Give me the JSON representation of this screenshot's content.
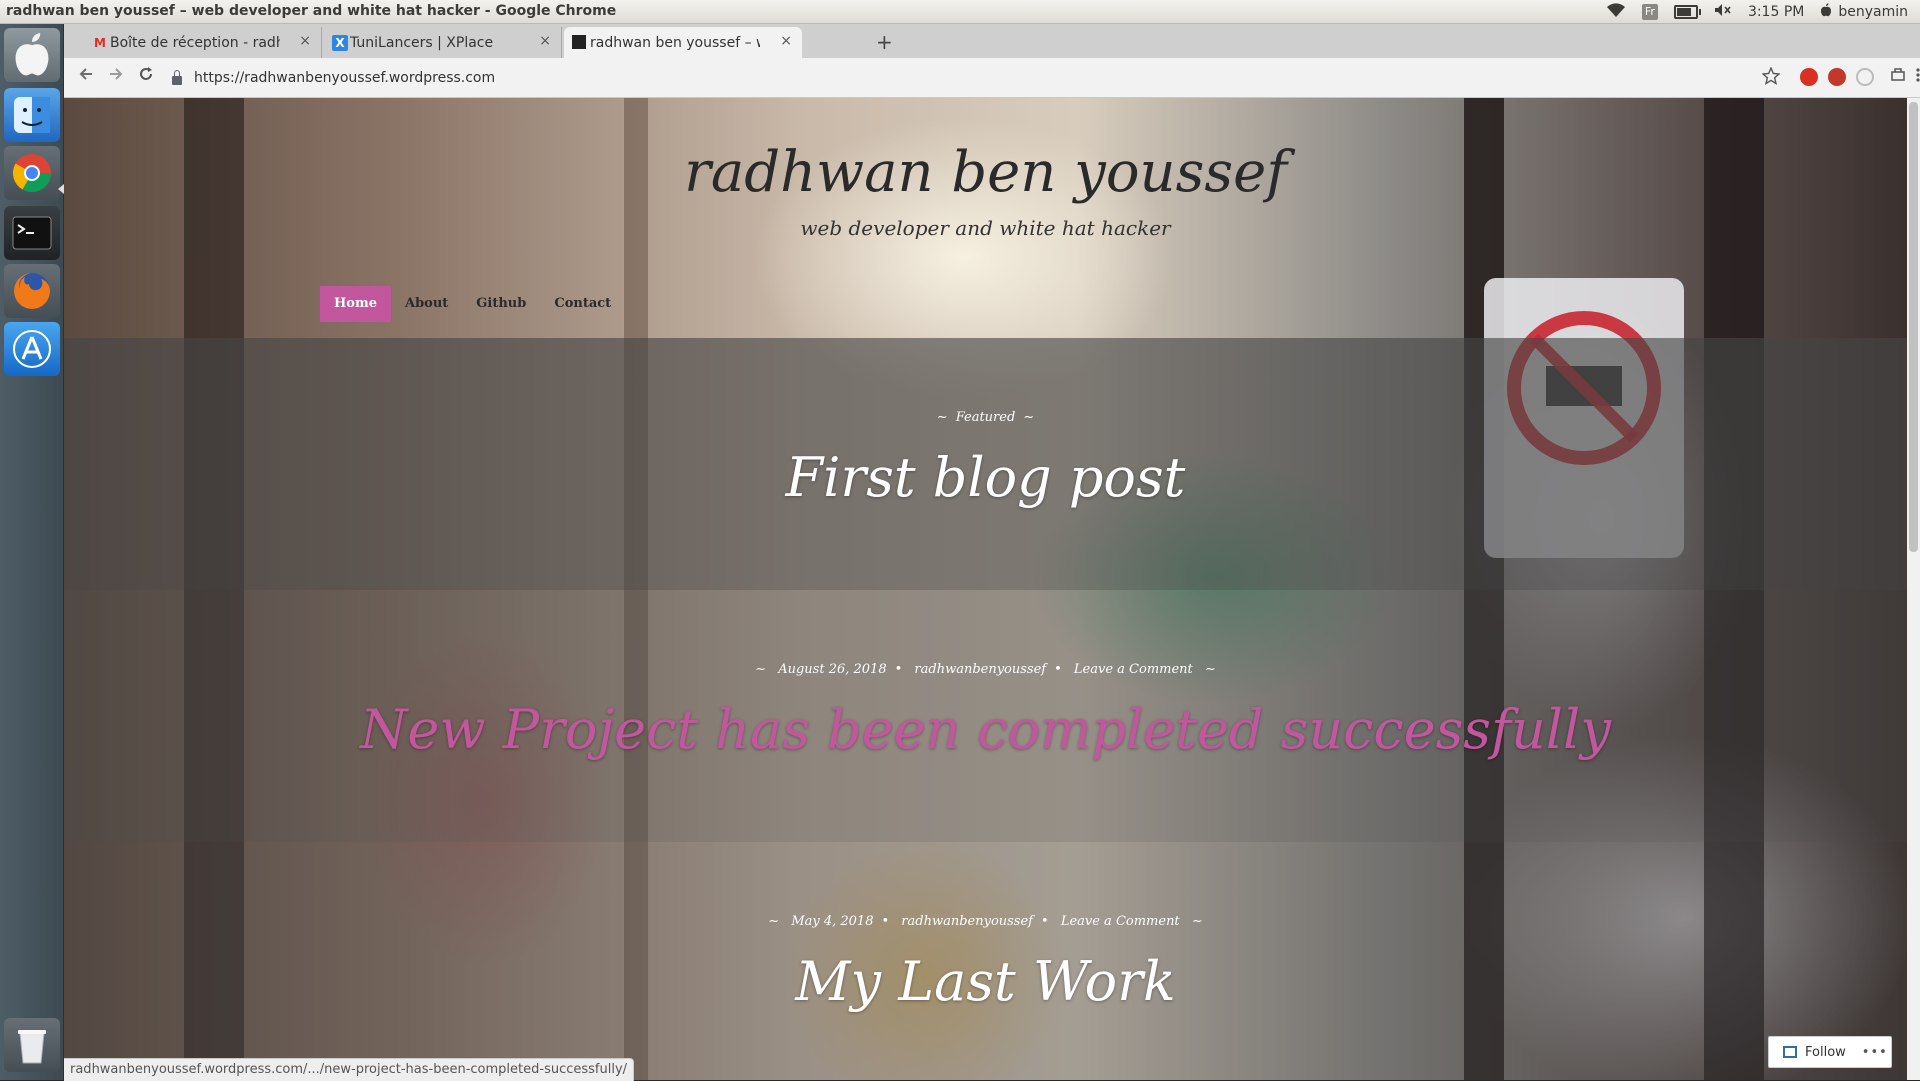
{
  "os": {
    "window_title": "radhwan ben youssef – web developer and white hat hacker - Google Chrome",
    "keyboard_layout": "Fr",
    "time": "3:15 PM",
    "user": "benyamin",
    "icons": [
      "wifi-icon",
      "keyboard-layout-icon",
      "battery-icon",
      "volume-muted-icon",
      "apple-menu-icon"
    ]
  },
  "launcher": {
    "items": [
      "apple-icon",
      "finder-icon",
      "chrome-icon",
      "terminal-icon",
      "firefox-icon",
      "app-store-icon",
      "trash-icon"
    ]
  },
  "browser": {
    "tabs": [
      {
        "title": "Boîte de réception - radhwanbenyoussef",
        "favicon": "gmail-icon",
        "favicon_glyph": "M",
        "active": false
      },
      {
        "title": "TuniLancers | XPlace",
        "favicon": "xplace-icon",
        "favicon_glyph": "X",
        "active": false
      },
      {
        "title": "radhwan ben youssef – web developer",
        "favicon": "wordpress-site-icon",
        "favicon_glyph": "▪",
        "active": true
      }
    ],
    "close_glyph": "×",
    "new_tab_glyph": "+",
    "url": "https://radhwanbenyoussef.wordpress.com",
    "toolbar_icons": [
      "back-icon",
      "forward-icon",
      "reload-icon",
      "lock-icon",
      "bookmark-star-icon",
      "extension-adblock-icon",
      "extension-ublock-icon",
      "extension-generic-icon",
      "extension-puzzle-icon",
      "menu-kebab-icon"
    ],
    "status_url": "radhwanbenyoussef.wordpress.com/.../new-project-has-been-completed-successfully/"
  },
  "site": {
    "title": "radhwan ben youssef",
    "tagline": "web developer and white hat hacker",
    "nav": [
      {
        "label": "Home",
        "current": true
      },
      {
        "label": "About",
        "current": false
      },
      {
        "label": "Github",
        "current": false
      },
      {
        "label": "Contact",
        "current": false
      }
    ],
    "accent_color": "#c2579e",
    "posts": [
      {
        "meta": [
          "Featured"
        ],
        "title": "First blog post"
      },
      {
        "meta": [
          "August 26, 2018",
          "radhwanbenyoussef",
          "Leave a Comment"
        ],
        "title": "New Project has been completed successfully"
      },
      {
        "meta": [
          "May 4, 2018",
          "radhwanbenyoussef",
          "Leave a Comment"
        ],
        "title": "My Last Work"
      }
    ]
  },
  "follow_widget": {
    "label": "Follow",
    "more": "•••"
  }
}
